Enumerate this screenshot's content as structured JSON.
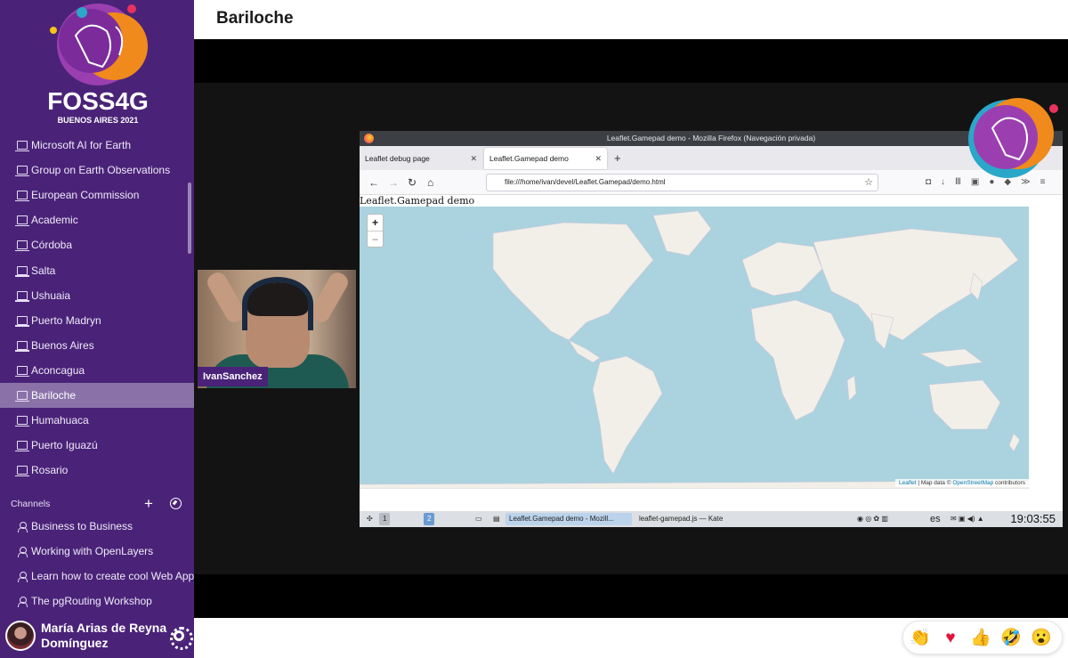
{
  "event": {
    "logo_text": "FOSS4G",
    "logo_subtext": "BUENOS AIRES 2021"
  },
  "header": {
    "room_title": "Bariloche"
  },
  "sidebar": {
    "rooms": [
      {
        "label": "Microsoft AI for Earth",
        "active": false
      },
      {
        "label": "Group on Earth Observations",
        "active": false
      },
      {
        "label": "European Commission",
        "active": false
      },
      {
        "label": "Academic",
        "active": false
      },
      {
        "label": "Córdoba",
        "active": false
      },
      {
        "label": "Salta",
        "active": false
      },
      {
        "label": "Ushuaia",
        "active": false
      },
      {
        "label": "Puerto Madryn",
        "active": false
      },
      {
        "label": "Buenos Aires",
        "active": false
      },
      {
        "label": "Aconcagua",
        "active": false
      },
      {
        "label": "Bariloche",
        "active": true
      },
      {
        "label": "Humahuaca",
        "active": false
      },
      {
        "label": "Puerto Iguazú",
        "active": false
      },
      {
        "label": "Rosario",
        "active": false
      }
    ],
    "channels_heading": "Channels",
    "add_symbol": "+",
    "channels": [
      {
        "label": "Business to Business"
      },
      {
        "label": "Working with OpenLayers"
      },
      {
        "label": "Learn how to create cool Web Appli..."
      },
      {
        "label": "The pgRouting Workshop"
      }
    ],
    "user": {
      "name": "María Arias de Reyna Domínguez"
    },
    "colors": {
      "background": "#4a2378",
      "active_item": "#8a72a9"
    }
  },
  "stage": {
    "camera": {
      "participant_name": "IvanSanchez"
    },
    "screen": {
      "window_title": "Leaflet.Gamepad demo - Mozilla Firefox (Navegación privada)",
      "tabs": [
        {
          "label": "Leaflet debug page",
          "close": "✕"
        },
        {
          "label": "Leaflet.Gamepad demo",
          "close": "✕"
        }
      ],
      "new_tab": "+",
      "nav": {
        "back": "←",
        "forward": "→",
        "reload": "↻",
        "home": "⌂"
      },
      "url": "file:///home/ivan/devel/Leaflet.Gamepad/demo.html",
      "star": "☆",
      "page_heading": "Leaflet.Gamepad demo",
      "zoom_in": "+",
      "zoom_out": "−",
      "attribution": {
        "leaflet": "Leaflet",
        "mid": " | Map data © ",
        "osm": "OpenStreetMap",
        "end": " contributors"
      },
      "taskbar": {
        "desktop_1": "1",
        "desktop_2": "2",
        "firefox_task": "Leaflet.Gamepad demo - Mozill...",
        "kate_task": "leaflet-gamepad.js  — Kate",
        "language": "es",
        "clock": "19:03:55"
      }
    }
  },
  "reactions": [
    {
      "name": "clap",
      "glyph": "👏"
    },
    {
      "name": "heart",
      "glyph": "♥"
    },
    {
      "name": "thumbs-up",
      "glyph": "👍"
    },
    {
      "name": "laughing",
      "glyph": "🤣"
    },
    {
      "name": "surprised",
      "glyph": "😮"
    }
  ]
}
